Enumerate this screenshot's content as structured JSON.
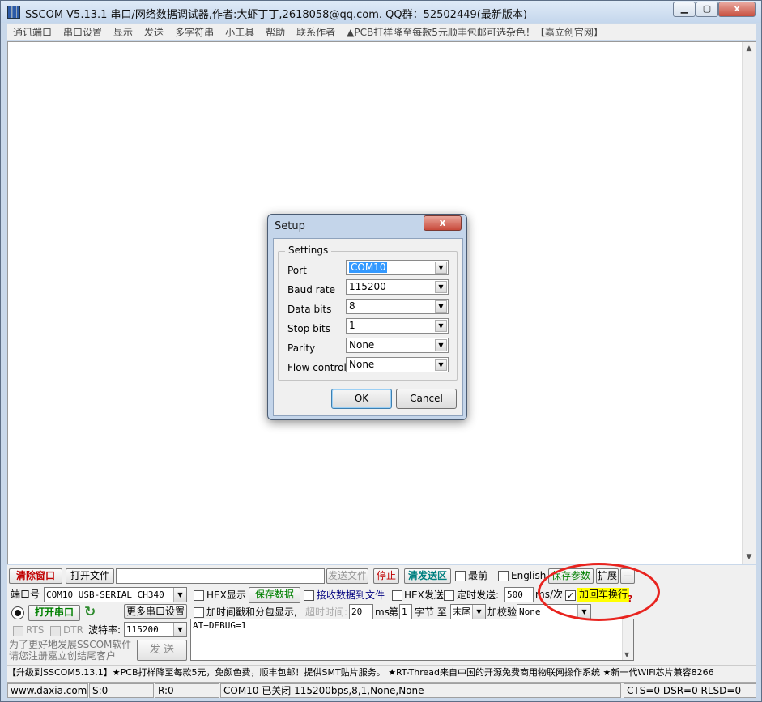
{
  "window": {
    "title": "SSCOM V5.13.1 串口/网络数据调试器,作者:大虾丁丁,2618058@qq.com. QQ群：52502449(最新版本)",
    "min": "0",
    "max": "1",
    "close": "x"
  },
  "menu": [
    "通讯端口",
    "串口设置",
    "显示",
    "发送",
    "多字符串",
    "小工具",
    "帮助",
    "联系作者",
    "▲PCB打样降至每款5元顺丰包邮可选杂色！【嘉立创官网】"
  ],
  "toolbar": {
    "clear_window": "清除窗口",
    "open_file": "打开文件",
    "send_file": "发送文件",
    "stop": "停止",
    "clear_send": "清发送区",
    "last": "最前",
    "english": "English",
    "save_params": "保存参数",
    "expand": "扩展",
    "minus": "—"
  },
  "port": {
    "port_label": "端口号",
    "port_value": "COM10 USB-SERIAL CH340",
    "hex_display": "HEX显示",
    "save_data": "保存数据",
    "recv_to_file": "接收数据到文件",
    "hex_send": "HEX发送",
    "timed_send": "定时发送:",
    "timed_interval": "500",
    "ms_per": "ms/次",
    "add_crlf": "加回车换行",
    "more_settings": "更多串口设置",
    "timestamp": "加时间戳和分包显示,",
    "timeout_label": "超时时间:",
    "timeout_value": "20",
    "ms": "ms",
    "nth_label": "第",
    "nth_value": "1",
    "byte_label": "字节 至",
    "tail": "末尾",
    "checksum_label": "加校验",
    "checksum_value": "None",
    "open_port": "打开串口",
    "rts": "RTS",
    "dtr": "DTR",
    "baud_label": "波特率:",
    "baud_value": "115200",
    "send_text": "AT+DEBUG=1",
    "promo_line1": "为了更好地发展SSCOM软件",
    "promo_line2": "请您注册嘉立创结尾客户",
    "send": "发 送",
    "help_mark": "?"
  },
  "ticker": "【升级到SSCOM5.13.1】★PCB打样降至每款5元，免颜色费，顺丰包邮！提供SMT贴片服务。 ★RT-Thread来自中国的开源免费商用物联网操作系统 ★新一代WiFi芯片兼容8266",
  "status": {
    "site": "www.daxia.com",
    "sent": "S:0",
    "recv": "R:0",
    "conn": "COM10 已关闭  115200bps,8,1,None,None",
    "lines": "CTS=0 DSR=0 RLSD=0"
  },
  "dialog": {
    "title": "Setup",
    "close": "x",
    "group": "Settings",
    "port_label": "Port",
    "port_value": "COM10",
    "baud_label": "Baud rate",
    "baud_value": "115200",
    "data_label": "Data bits",
    "data_value": "8",
    "stop_label": "Stop bits",
    "stop_value": "1",
    "parity_label": "Parity",
    "parity_value": "None",
    "flow_label": "Flow control",
    "flow_value": "None",
    "ok": "OK",
    "cancel": "Cancel"
  },
  "colors": {
    "accent_red": "#e8241f",
    "crlf_highlight": "#ffff00",
    "green_text": "#008000",
    "selection": "#3399ff"
  }
}
